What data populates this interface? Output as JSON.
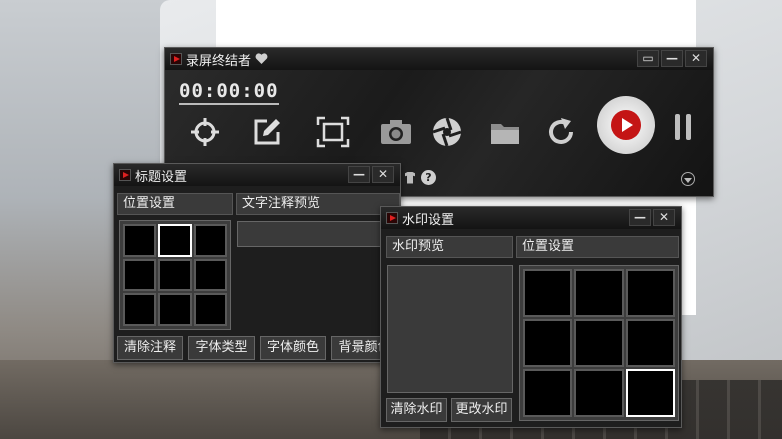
{
  "recorder": {
    "title": "录屏终结者",
    "timer": "00:00:00",
    "tools": [
      {
        "icon": "crosshair-icon"
      },
      {
        "icon": "edit-icon"
      },
      {
        "icon": "fullscreen-capture-icon"
      },
      {
        "icon": "camera-icon"
      },
      {
        "icon": "aperture-icon"
      },
      {
        "icon": "folder-icon"
      },
      {
        "icon": "refresh-icon"
      }
    ],
    "help_glyph": "?",
    "title_buttons": {
      "restore": "▭",
      "minimize": "—",
      "close": "✕"
    }
  },
  "title_window": {
    "title": "标题设置",
    "position_label": "位置设置",
    "preview_label": "文字注释预览",
    "selected_cell": 1,
    "buttons": [
      "清除注释",
      "字体类型",
      "字体颜色",
      "背景颜色"
    ],
    "title_buttons": {
      "minimize": "—",
      "close": "✕"
    }
  },
  "watermark_window": {
    "title": "水印设置",
    "preview_label": "水印预览",
    "position_label": "位置设置",
    "selected_cell": 8,
    "buttons": [
      "清除水印",
      "更改水印"
    ],
    "title_buttons": {
      "minimize": "—",
      "close": "✕"
    }
  },
  "colors": {
    "accent_red": "#c41515",
    "window_bg": "#1e1e1e"
  }
}
